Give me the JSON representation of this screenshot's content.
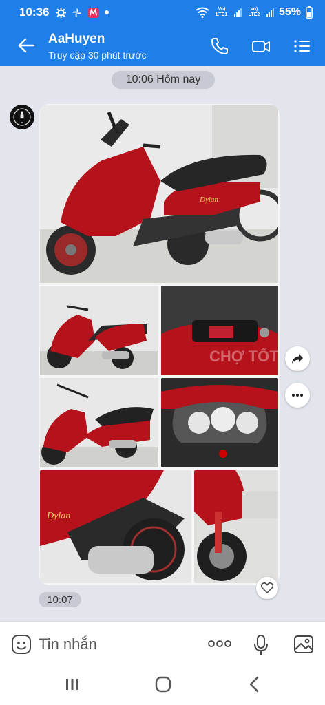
{
  "status_bar": {
    "time": "10:36",
    "battery": "55%",
    "sim1": "Vo) LTE1",
    "sim2": "Vo) LTE2"
  },
  "header": {
    "contact_name": "AaHuyen",
    "last_seen": "Truy cập 30 phút trước"
  },
  "chat": {
    "date_divider": "10:06 Hôm nay",
    "message_time": "10:07",
    "watermark": "CHỢ TỐT",
    "photo_count": 7
  },
  "composer": {
    "placeholder": "Tin nhắn"
  },
  "colors": {
    "accent": "#1f7fe8",
    "background": "#e3e5ed",
    "scooter_red": "#b5121b"
  }
}
